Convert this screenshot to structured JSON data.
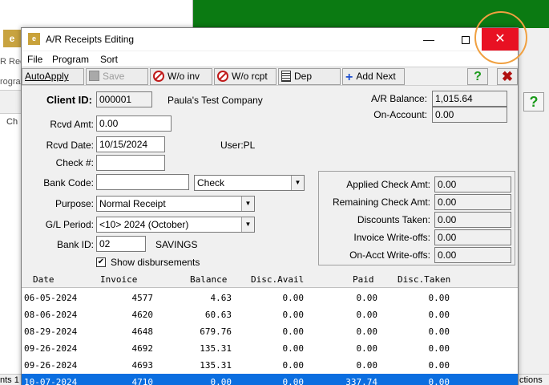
{
  "background": {
    "tab_label": "Ch",
    "text1": "R Rec",
    "text2": "rogra",
    "help_icon": "?",
    "bottom_left": "nts 1",
    "bottom_right": "ctions"
  },
  "window": {
    "title": "A/R Receipts Editing",
    "icon_text": "e",
    "close_glyph": "✕",
    "min_glyph": "—"
  },
  "menu": [
    "File",
    "Program",
    "Sort"
  ],
  "toolbar": {
    "autoapply": "AutoApply",
    "save": "Save",
    "wo_inv": "W/o inv",
    "wo_rcpt": "W/o rcpt",
    "dep": "Dep",
    "add_next": "Add Next",
    "help": "?",
    "close": "✖"
  },
  "client": {
    "id_label": "Client ID:",
    "id_value": "000001",
    "name": "Paula's Test Company"
  },
  "balance": {
    "ar_label": "A/R Balance:",
    "ar_value": "1,015.64",
    "onaccount_label": "On-Account:",
    "onaccount_value": "0.00"
  },
  "form": {
    "rcvd_amt_label": "Rcvd Amt:",
    "rcvd_amt_value": "0.00",
    "rcvd_date_label": "Rcvd Date:",
    "rcvd_date_value": "10/15/2024",
    "user_label": "User:PL",
    "check_label": "Check #:",
    "check_value": "",
    "bank_code_label": "Bank Code:",
    "bank_code_value": "",
    "pay_type": "Check",
    "purpose_label": "Purpose:",
    "purpose_value": "Normal Receipt",
    "gl_period_label": "G/L Period:",
    "gl_period_value": "<10> 2024 (October)",
    "bank_id_label": "Bank ID:",
    "bank_id_value": "02",
    "bank_name": "SAVINGS",
    "show_disb_label": "Show disbursements",
    "show_disb_checked": "✔"
  },
  "summary": {
    "applied_label": "Applied Check Amt:",
    "applied_value": "0.00",
    "remaining_label": "Remaining Check Amt:",
    "remaining_value": "0.00",
    "discounts_label": "Discounts Taken:",
    "discounts_value": "0.00",
    "inv_wo_label": "Invoice Write-offs:",
    "inv_wo_value": "0.00",
    "acct_wo_label": "On-Acct Write-offs:",
    "acct_wo_value": "0.00"
  },
  "grid": {
    "headers": [
      "Date",
      "Invoice",
      "Balance",
      "Disc.Avail",
      "Paid",
      "Disc.Taken"
    ],
    "rows": [
      [
        "06-05-2024",
        "4577",
        "4.63",
        "0.00",
        "0.00",
        "0.00"
      ],
      [
        "08-06-2024",
        "4620",
        "60.63",
        "0.00",
        "0.00",
        "0.00"
      ],
      [
        "08-29-2024",
        "4648",
        "679.76",
        "0.00",
        "0.00",
        "0.00"
      ],
      [
        "09-26-2024",
        "4692",
        "135.31",
        "0.00",
        "0.00",
        "0.00"
      ],
      [
        "09-26-2024",
        "4693",
        "135.31",
        "0.00",
        "0.00",
        "0.00"
      ],
      [
        "10-07-2024",
        "4710",
        "0.00",
        "0.00",
        "337.74",
        "0.00"
      ]
    ]
  },
  "colors": {
    "accent_close": "#e81123",
    "selection": "#0b6ee0",
    "app_green": "#0b7a12"
  }
}
